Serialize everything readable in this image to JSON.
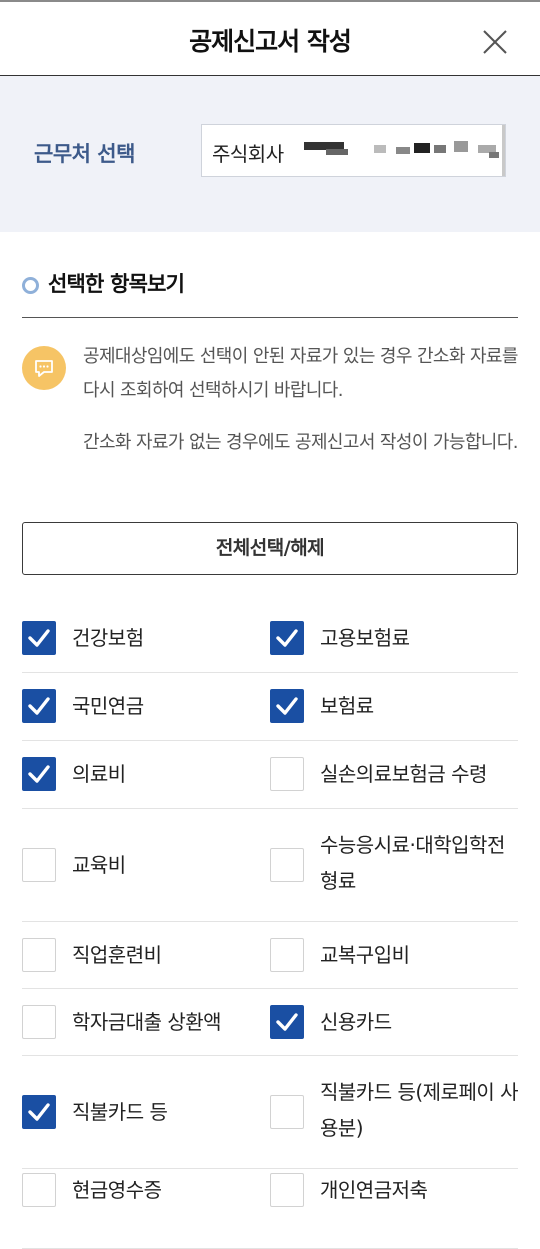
{
  "header": {
    "title": "공제신고서 작성"
  },
  "workplace": {
    "label": "근무처 선택",
    "selected_value": "주식회사"
  },
  "section": {
    "title": "선택한 항목보기"
  },
  "notice": {
    "line1": "공제대상임에도 선택이 안된 자료가 있는 경우 간소화 자료를 다시 조회하여 선택하시기 바랍니다.",
    "line2": "간소화 자료가 없는 경우에도 공제신고서 작성이 가능합니다."
  },
  "toggle_all_label": "전체선택/해제",
  "items": [
    {
      "label": "건강보험",
      "checked": true
    },
    {
      "label": "고용보험료",
      "checked": true
    },
    {
      "label": "국민연금",
      "checked": true
    },
    {
      "label": "보험료",
      "checked": true
    },
    {
      "label": "의료비",
      "checked": true
    },
    {
      "label": "실손의료보험금 수령",
      "checked": false
    },
    {
      "label": "교육비",
      "checked": false
    },
    {
      "label": "수능응시료·대학입학전형료",
      "checked": false
    },
    {
      "label": "직업훈련비",
      "checked": false
    },
    {
      "label": "교복구입비",
      "checked": false
    },
    {
      "label": "학자금대출 상환액",
      "checked": false
    },
    {
      "label": "신용카드",
      "checked": true
    },
    {
      "label": "직불카드 등",
      "checked": true
    },
    {
      "label": "직불카드 등(제로페이 사용분)",
      "checked": false
    },
    {
      "label": "현금영수증",
      "checked": false
    },
    {
      "label": "개인연금저축",
      "checked": false
    }
  ],
  "colors": {
    "accent": "#1a4fa3",
    "label_blue": "#3d5a8a",
    "notice_icon": "#f6c465"
  },
  "icons": {
    "close": "close-icon",
    "notice": "speech-bubble-icon",
    "check": "check-icon",
    "section": "ring-bullet-icon"
  }
}
